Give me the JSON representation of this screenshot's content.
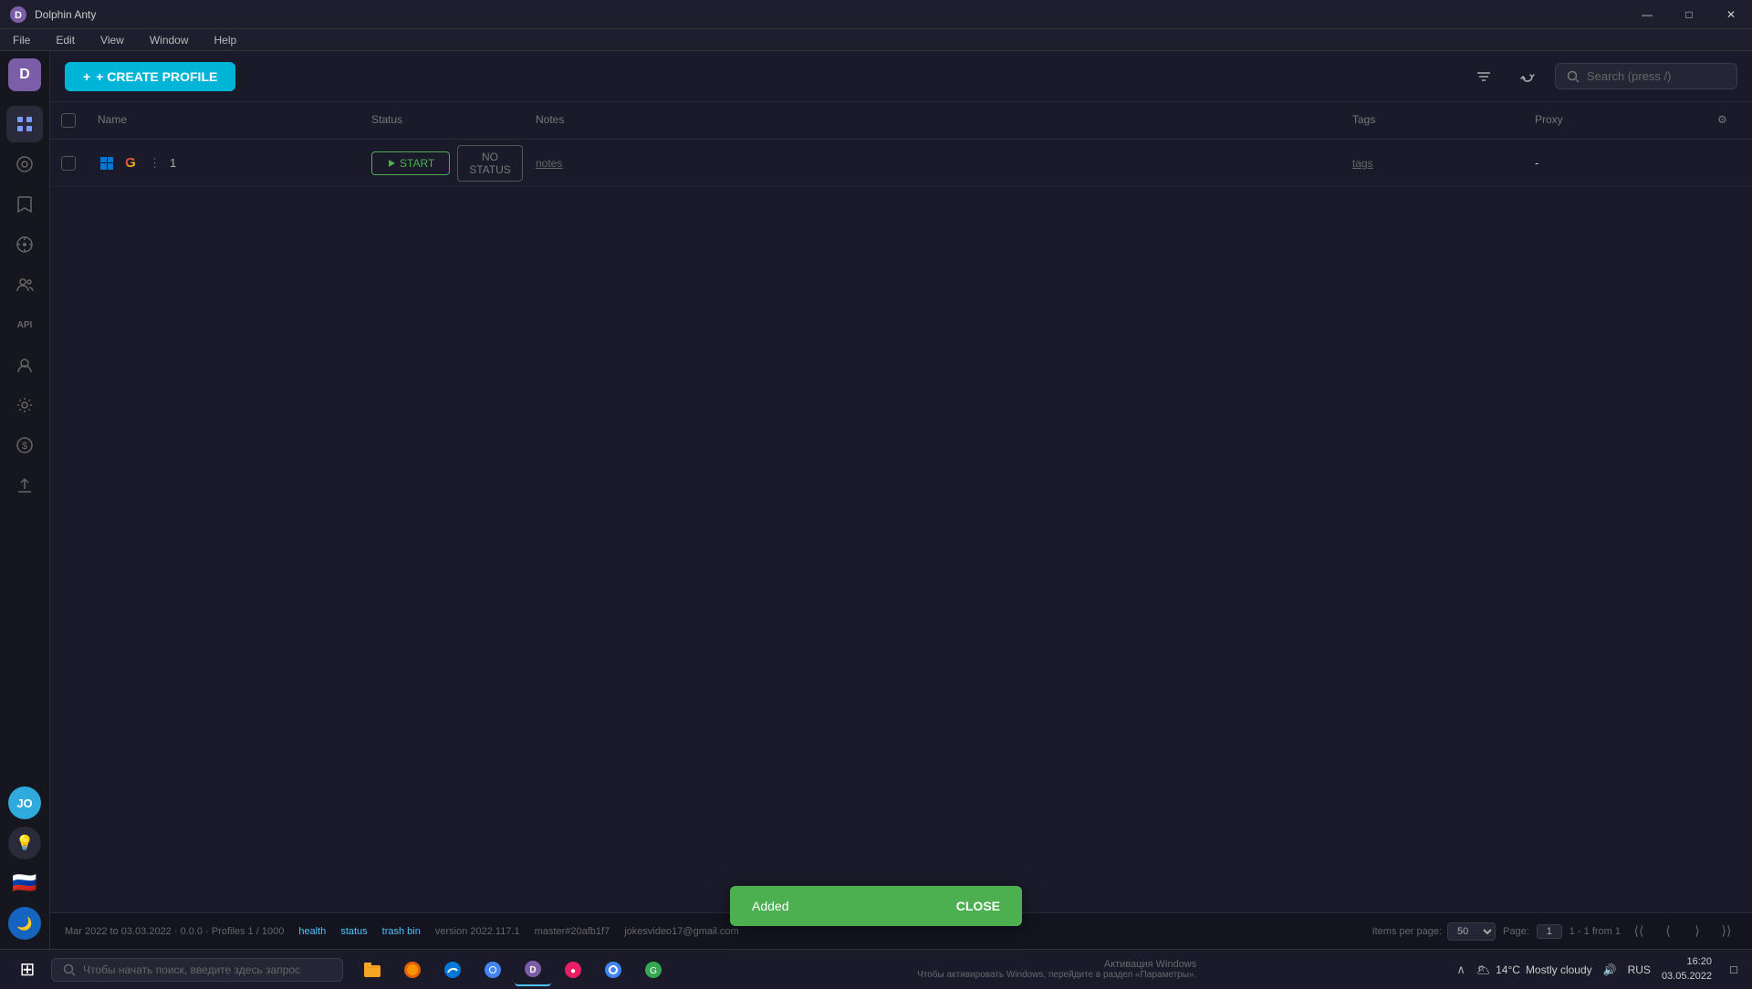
{
  "app": {
    "title": "Dolphin Anty",
    "title_bar_min": "—",
    "title_bar_max": "□",
    "title_bar_close": "✕"
  },
  "menu": {
    "items": [
      "File",
      "Edit",
      "View",
      "Window",
      "Help"
    ]
  },
  "toolbar": {
    "create_profile_label": "+ CREATE PROFILE",
    "search_placeholder": "Search (press /)"
  },
  "table": {
    "headers": {
      "checkbox": "",
      "name": "Name",
      "status": "Status",
      "notes": "Notes",
      "tags": "Tags",
      "proxy": "Proxy",
      "settings": ""
    },
    "rows": [
      {
        "id": "1",
        "start_label": "START",
        "no_status_label": "NO STATUS",
        "notes_label": "notes",
        "tags_label": "tags",
        "proxy": "-"
      }
    ]
  },
  "sidebar": {
    "logo": "D",
    "avatar_initials": "JO",
    "items": [
      {
        "icon": "⊞",
        "label": "profiles",
        "active": true
      },
      {
        "icon": "◎",
        "label": "cookies"
      },
      {
        "icon": "⚑",
        "label": "bookmark"
      },
      {
        "icon": "☺",
        "label": "extensions"
      },
      {
        "icon": "⚊",
        "label": "members"
      },
      {
        "icon": "API",
        "label": "api"
      },
      {
        "icon": "⚿",
        "label": "accounts"
      },
      {
        "icon": "⚙",
        "label": "settings"
      },
      {
        "icon": "$",
        "label": "billing"
      },
      {
        "icon": "↗",
        "label": "export"
      }
    ]
  },
  "status_bar": {
    "info_text": "Mar 2022 to 03.03.2022 · 0.0.0 · Profiles 1 / 1000",
    "health_link": "health",
    "status_link": "status",
    "trash_bin_link": "trash bin",
    "version_text": "version 2022.117.1",
    "branch_text": "master#20afb1f7",
    "user_email": "jokesvideo17@gmail.com",
    "per_page_label": "Items per page:",
    "per_page_value": "50",
    "page_label": "Page:",
    "page_value": "1",
    "pagination_info": "1 - 1 from 1"
  },
  "toast": {
    "message": "Added",
    "close_label": "CLOSE"
  },
  "taskbar": {
    "search_placeholder": "Чтобы начать поиск, введите здесь запрос",
    "weather_temp": "14°C",
    "weather_desc": "Mostly cloudy",
    "language": "RUS",
    "time": "16:20",
    "date": "03.05.2022",
    "activation_notice": "Активация Windows",
    "activation_hint": "Чтобы активировать Windows, перейдите в раздел «Параметры»."
  }
}
